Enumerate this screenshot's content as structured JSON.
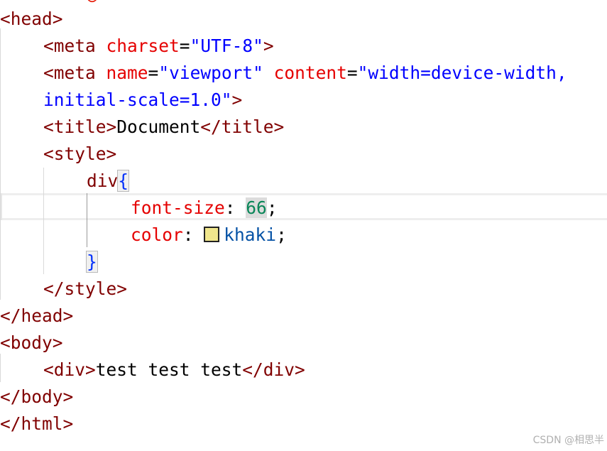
{
  "code": {
    "head_open": "<head>",
    "meta1_open": "<meta",
    "meta1_attr": "charset",
    "meta1_eq": "=",
    "meta1_val": "\"UTF-8\"",
    "meta1_close": ">",
    "meta2_open": "<meta",
    "meta2_attr1": "name",
    "meta2_eq1": "=",
    "meta2_val1": "\"viewport\"",
    "meta2_attr2": "content",
    "meta2_eq2": "=",
    "meta2_val2_part1": "\"width=device-width,",
    "meta2_val2_part2": "initial-scale=1.0\"",
    "meta2_close": ">",
    "title_open": "<title>",
    "title_text": "Document",
    "title_close": "</title>",
    "style_open": "<style>",
    "selector": "div",
    "brace_open": "{",
    "prop1": "font-size",
    "colon1": ":",
    "value1": "66",
    "semi1": ";",
    "prop2": "color",
    "colon2": ":",
    "value2": "khaki",
    "semi2": ";",
    "brace_close": "}",
    "style_close": "</style>",
    "head_close": "</head>",
    "body_open": "<body>",
    "div_open": "<div>",
    "div_text": "test test test",
    "div_close": "</div>",
    "body_close": "</body>",
    "html_close": "</html>"
  },
  "colors": {
    "swatch_khaki": "#f0e68c"
  },
  "watermark": "CSDN @相思半"
}
